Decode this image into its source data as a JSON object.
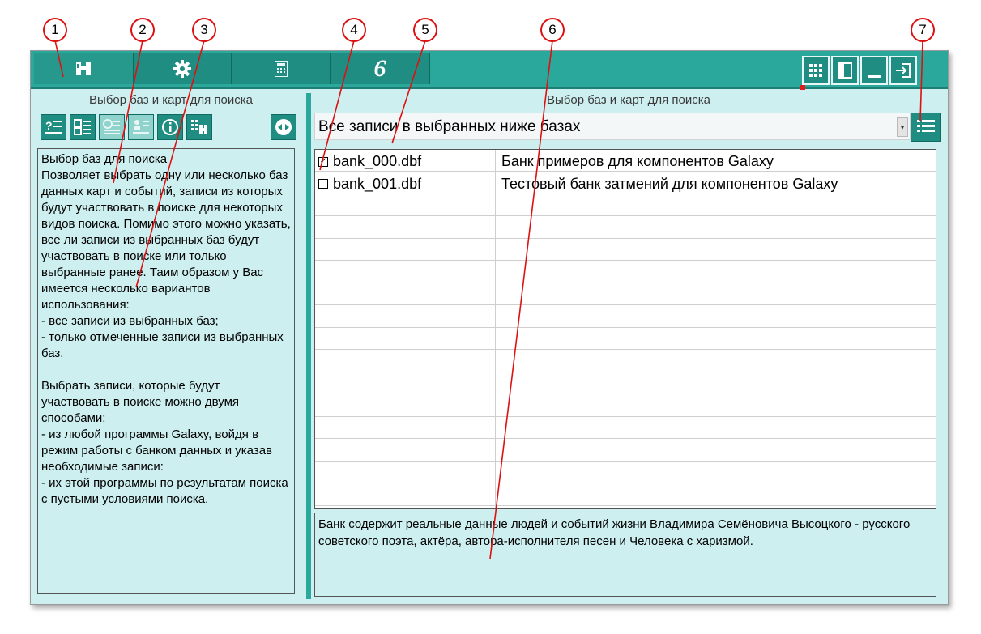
{
  "toolbar": {
    "tabs": [
      {
        "name": "search",
        "icon": "binoculars-icon"
      },
      {
        "name": "settings",
        "icon": "gear-icon"
      },
      {
        "name": "calculator",
        "icon": "calculator-icon"
      },
      {
        "name": "galaxy",
        "icon": "galaxy-logo-icon",
        "glyph": "6"
      }
    ],
    "right_buttons": [
      {
        "name": "grid-view",
        "icon": "grid-icon"
      },
      {
        "name": "panel-toggle",
        "icon": "panel-icon"
      },
      {
        "name": "minimize",
        "icon": "minimize-icon"
      },
      {
        "name": "exit",
        "icon": "exit-icon"
      }
    ]
  },
  "left": {
    "title": "Выбор баз и карт для поиска",
    "buttons": [
      {
        "name": "help",
        "icon": "question-list-icon",
        "active": true
      },
      {
        "name": "select-bases",
        "icon": "database-list-icon",
        "active": true
      },
      {
        "name": "time-filter",
        "icon": "clock-list-icon",
        "active": false
      },
      {
        "name": "people-filter",
        "icon": "people-list-icon",
        "active": false
      },
      {
        "name": "info",
        "icon": "info-icon",
        "active": true
      },
      {
        "name": "search-cards",
        "icon": "card-search-icon",
        "active": true
      },
      {
        "name": "navigator",
        "icon": "navigator-icon",
        "active": true
      }
    ],
    "help_paragraphs": [
      "Выбор баз для поиска\nПозволяет выбрать одну или несколько баз данных карт и событий, записи из которых будут участвовать в поиске для некоторых видов поиска. Помимо этого можно указать, все ли записи из выбранных баз будут участвовать в поиске или только выбранные ранее. Таим образом у Вас имеется несколько вариантов использования:\n- все записи из выбранных баз;\n- только отмеченные записи из выбранных баз.",
      "Выбрать записи, которые будут участвовать в поиске можно двумя способами:\n- из любой программы Galaxy, войдя в режим работы с банком данных и указав необходимые записи:\n- их этой программы по результатам поиска с пустыми условиями поиска."
    ]
  },
  "right": {
    "title": "Выбор баз и карт для поиска",
    "select_value": "Все записи в выбранных ниже базах",
    "rows": [
      {
        "checked": true,
        "file": "bank_000.dbf",
        "desc": "Банк примеров для компонентов Galaxy"
      },
      {
        "checked": false,
        "file": "bank_001.dbf",
        "desc": "Тестовый банк затмений для компонентов Galaxy"
      },
      {
        "checked": null,
        "file": "",
        "desc": ""
      },
      {
        "checked": null,
        "file": "",
        "desc": ""
      },
      {
        "checked": null,
        "file": "",
        "desc": ""
      },
      {
        "checked": null,
        "file": "",
        "desc": ""
      },
      {
        "checked": null,
        "file": "",
        "desc": ""
      },
      {
        "checked": null,
        "file": "",
        "desc": ""
      },
      {
        "checked": null,
        "file": "",
        "desc": ""
      },
      {
        "checked": null,
        "file": "",
        "desc": ""
      },
      {
        "checked": null,
        "file": "",
        "desc": ""
      },
      {
        "checked": null,
        "file": "",
        "desc": ""
      },
      {
        "checked": null,
        "file": "",
        "desc": ""
      },
      {
        "checked": null,
        "file": "",
        "desc": ""
      },
      {
        "checked": null,
        "file": "",
        "desc": ""
      },
      {
        "checked": null,
        "file": "",
        "desc": ""
      }
    ],
    "description": "Банк содержит реальные данные людей и событий жизни Владимира Семёновича Высоцкого - русского  советского поэта, актёра, автора-исполнителя песен и Человека с харизмой."
  },
  "callouts": [
    "1",
    "2",
    "3",
    "4",
    "5",
    "6",
    "7"
  ],
  "colors": {
    "accent": "#1f8d82",
    "panel": "#cdeff0",
    "callout": "#dd1111"
  }
}
